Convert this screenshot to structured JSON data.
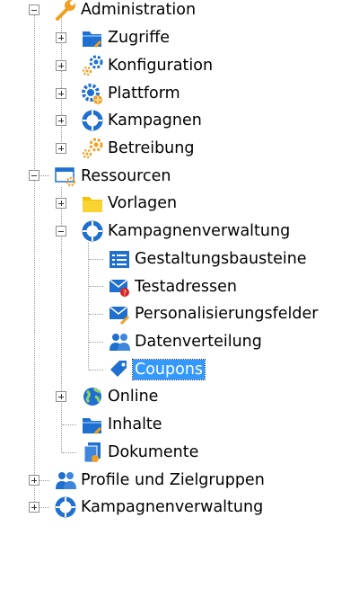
{
  "tree": {
    "administration": {
      "label": "Administration",
      "icon": "wrench-icon",
      "expanded": true,
      "children": {
        "zugriffe": {
          "label": "Zugriffe",
          "icon": "folder-user-icon",
          "expanded": false
        },
        "konfiguration": {
          "label": "Konfiguration",
          "icon": "gears-icon",
          "expanded": false
        },
        "plattform": {
          "label": "Plattform",
          "icon": "gear-globe-icon",
          "expanded": false
        },
        "kampagnen": {
          "label": "Kampagnen",
          "icon": "campaign-ring-icon",
          "expanded": false
        },
        "betreibung": {
          "label": "Betreibung",
          "icon": "orange-gears-icon",
          "expanded": false
        }
      }
    },
    "ressourcen": {
      "label": "Ressourcen",
      "icon": "window-gear-icon",
      "expanded": true,
      "children": {
        "vorlagen": {
          "label": "Vorlagen",
          "icon": "folder-icon",
          "expanded": false
        },
        "kampagnenverwaltung": {
          "label": "Kampagnenverwaltung",
          "icon": "campaign-ring-icon",
          "expanded": true,
          "children": {
            "gestaltungsbausteine": {
              "label": "Gestaltungsbausteine",
              "icon": "list-blocks-icon"
            },
            "testadressen": {
              "label": "Testadressen",
              "icon": "envelope-question-icon"
            },
            "personalisierungsfelder": {
              "label": "Personalisierungsfelder",
              "icon": "envelope-pen-icon"
            },
            "datenverteilung": {
              "label": "Datenverteilung",
              "icon": "people-icon"
            },
            "coupons": {
              "label": "Coupons",
              "icon": "tag-icon",
              "selected": true
            }
          }
        },
        "online": {
          "label": "Online",
          "icon": "globe-icon",
          "expanded": false
        },
        "inhalte": {
          "label": "Inhalte",
          "icon": "folder-pen-icon"
        },
        "dokumente": {
          "label": "Dokumente",
          "icon": "documents-icon"
        }
      }
    },
    "profile": {
      "label": "Profile und Zielgruppen",
      "icon": "people-icon",
      "expanded": false
    },
    "kampagnenverwaltung_root": {
      "label": "Kampagnenverwaltung",
      "icon": "campaign-ring-icon",
      "expanded": false
    }
  },
  "colors": {
    "selection": "#3399ff",
    "icon_blue": "#1f6fd0",
    "icon_orange": "#f0a020",
    "connector": "#9a9a9a"
  }
}
